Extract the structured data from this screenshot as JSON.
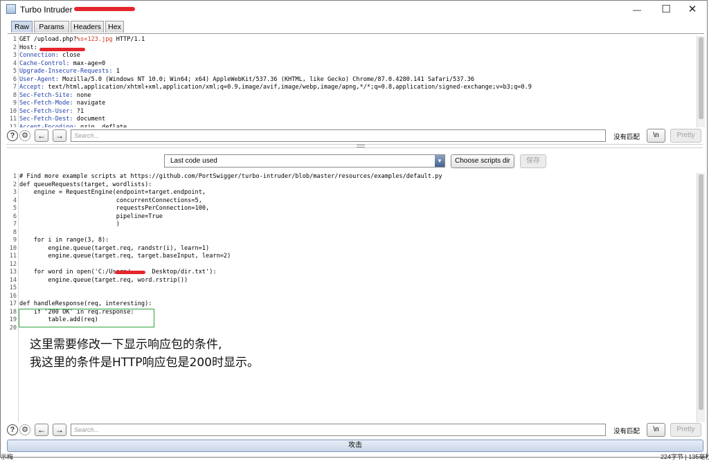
{
  "window": {
    "title": "Turbo Intruder - ",
    "controls": {
      "minimize": "—",
      "maximize": "☐",
      "close": "✕"
    }
  },
  "tabs": [
    "Raw",
    "Params",
    "Headers",
    "Hex"
  ],
  "active_tab": "Raw",
  "request": {
    "lines": [
      {
        "n": "1",
        "text": "GET /upload.php?%s=123.jpg HTTP/1.1"
      },
      {
        "n": "2",
        "text": "Host: "
      },
      {
        "n": "3",
        "name": "Connection:",
        "value": " close"
      },
      {
        "n": "4",
        "name": "Cache-Control:",
        "value": " max-age=0"
      },
      {
        "n": "5",
        "name": "Upgrade-Insecure-Requests:",
        "value": " 1"
      },
      {
        "n": "6",
        "name": "User-Agent:",
        "value": " Mozilla/5.0 (Windows NT 10.0; Win64; x64) AppleWebKit/537.36 (KHTML, like Gecko) Chrome/87.0.4280.141 Safari/537.36"
      },
      {
        "n": "7",
        "name": "Accept:",
        "value": " text/html,application/xhtml+xml,application/xml;q=0.9,image/avif,image/webp,image/apng,*/*;q=0.8,application/signed-exchange;v=b3;q=0.9"
      },
      {
        "n": "8",
        "name": "Sec-Fetch-Site:",
        "value": " none"
      },
      {
        "n": "9",
        "name": "Sec-Fetch-Mode:",
        "value": " navigate"
      },
      {
        "n": "10",
        "name": "Sec-Fetch-User:",
        "value": " ?1"
      },
      {
        "n": "11",
        "name": "Sec-Fetch-Dest:",
        "value": " document"
      },
      {
        "n": "12",
        "name": "Accept-Encoding:",
        "value": " gzip, deflate"
      }
    ]
  },
  "search": {
    "placeholder": "Search...",
    "no_match": "没有匹配",
    "newline_label": "\\n",
    "pretty_label": "Pretty",
    "help_icon": "?",
    "prev_icon": "←",
    "next_icon": "→"
  },
  "script_toolbar": {
    "dropdown_value": "Last code used",
    "choose_dir_label": "Choose scripts dir",
    "save_label": "保存"
  },
  "script": {
    "lines": [
      {
        "n": "1",
        "text": "# Find more example scripts at https://github.com/PortSwigger/turbo-intruder/blob/master/resources/examples/default.py"
      },
      {
        "n": "2",
        "text": "def queueRequests(target, wordlists):"
      },
      {
        "n": "3",
        "text": "    engine = RequestEngine(endpoint=target.endpoint,"
      },
      {
        "n": "4",
        "text": "                           concurrentConnections=5,"
      },
      {
        "n": "5",
        "text": "                           requestsPerConnection=100,"
      },
      {
        "n": "6",
        "text": "                           pipeline=True"
      },
      {
        "n": "7",
        "text": "                           )"
      },
      {
        "n": "8",
        "text": ""
      },
      {
        "n": "9",
        "text": "    for i in range(3, 8):"
      },
      {
        "n": "10",
        "text": "        engine.queue(target.req, randstr(i), learn=1)"
      },
      {
        "n": "11",
        "text": "        engine.queue(target.req, target.baseInput, learn=2)"
      },
      {
        "n": "12",
        "text": ""
      },
      {
        "n": "13",
        "text": "    for word in open('C:/Users/      Desktop/dir.txt'):"
      },
      {
        "n": "14",
        "text": "        engine.queue(target.req, word.rstrip())"
      },
      {
        "n": "15",
        "text": ""
      },
      {
        "n": "16",
        "text": ""
      },
      {
        "n": "17",
        "text": "def handleResponse(req, interesting):"
      },
      {
        "n": "18",
        "text": "    if '200 OK' in req.response:"
      },
      {
        "n": "19",
        "text": "        table.add(req)"
      },
      {
        "n": "20",
        "text": ""
      }
    ]
  },
  "annotation": {
    "line1": "这里需要修改一下显示响应包的条件,",
    "line2": "我这里的条件是HTTP响应包是200时显示。"
  },
  "attack_label": "攻击",
  "status": {
    "left": "示梅",
    "right": "224字节 | 135毫秒"
  },
  "colors": {
    "header_name": "#1f3fa8",
    "payload_marker": "#d2392a",
    "redaction": "#e5262c",
    "annotation_border": "#2aa33a",
    "active_tab": "#cfdaea"
  }
}
